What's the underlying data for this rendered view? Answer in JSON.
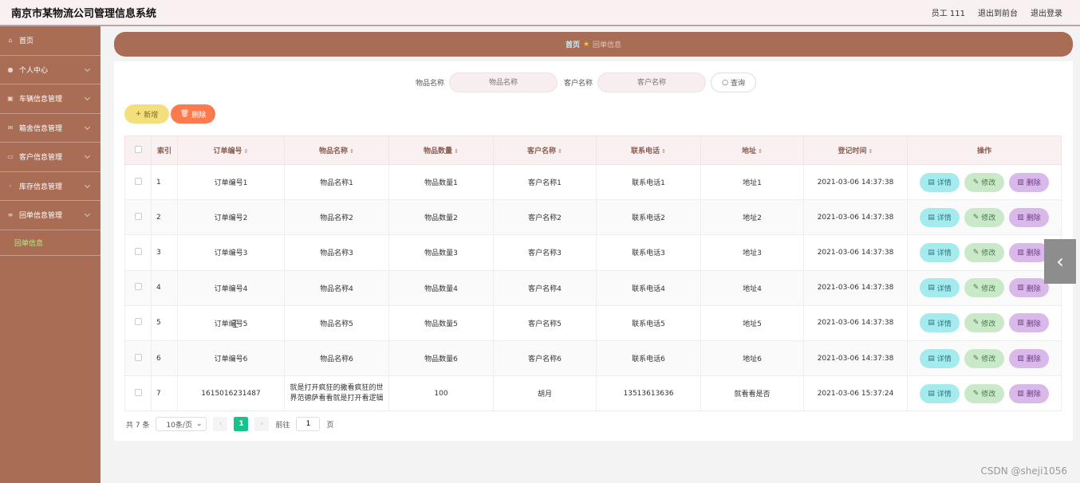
{
  "app": {
    "title": "南京市某物流公司管理信息系统"
  },
  "topbar": {
    "user": "员工 111",
    "to_front": "退出到前台",
    "logout": "退出登录"
  },
  "sidebar": {
    "items": [
      {
        "label": "首页",
        "icon": "home-icon"
      },
      {
        "label": "个人中心",
        "icon": "user-icon"
      },
      {
        "label": "车辆信息管理",
        "icon": "truck-icon"
      },
      {
        "label": "箱舍信息管理",
        "icon": "box-icon"
      },
      {
        "label": "客户信息管理",
        "icon": "customer-icon"
      },
      {
        "label": "库存信息管理",
        "icon": "stock-icon"
      },
      {
        "label": "回单信息管理",
        "icon": "list-icon"
      }
    ],
    "sub_item": "回单信息"
  },
  "breadcrumb": {
    "home": "首页",
    "current": "回单信息"
  },
  "search": {
    "label1": "物品名称",
    "placeholder1": "物品名称",
    "label2": "客户名称",
    "placeholder2": "客户名称",
    "button": "查询"
  },
  "actions": {
    "add": "新增",
    "delete": "删除"
  },
  "table": {
    "headers": [
      "索引",
      "订单编号",
      "物品名称",
      "物品数量",
      "客户名称",
      "联系电话",
      "地址",
      "登记时间",
      "操作"
    ],
    "rows": [
      {
        "idx": "1",
        "order": "订单编号1",
        "item": "物品名称1",
        "qty": "物品数量1",
        "cust": "客户名称1",
        "phone": "联系电话1",
        "addr": "地址1",
        "time": "2021-03-06 14:37:38"
      },
      {
        "idx": "2",
        "order": "订单编号2",
        "item": "物品名称2",
        "qty": "物品数量2",
        "cust": "客户名称2",
        "phone": "联系电话2",
        "addr": "地址2",
        "time": "2021-03-06 14:37:38"
      },
      {
        "idx": "3",
        "order": "订单编号3",
        "item": "物品名称3",
        "qty": "物品数量3",
        "cust": "客户名称3",
        "phone": "联系电话3",
        "addr": "地址3",
        "time": "2021-03-06 14:37:38"
      },
      {
        "idx": "4",
        "order": "订单编号4",
        "item": "物品名称4",
        "qty": "物品数量4",
        "cust": "客户名称4",
        "phone": "联系电话4",
        "addr": "地址4",
        "time": "2021-03-06 14:37:38"
      },
      {
        "idx": "5",
        "order": "订单编号5",
        "item": "物品名称5",
        "qty": "物品数量5",
        "cust": "客户名称5",
        "phone": "联系电话5",
        "addr": "地址5",
        "time": "2021-03-06 14:37:38"
      },
      {
        "idx": "6",
        "order": "订单编号6",
        "item": "物品名称6",
        "qty": "物品数量6",
        "cust": "客户名称6",
        "phone": "联系电话6",
        "addr": "地址6",
        "time": "2021-03-06 14:37:38"
      },
      {
        "idx": "7",
        "order": "1615016231487",
        "item": "就是打开疯狂的撒看疯狂的世界范德萨看看就是打开看逻辑",
        "qty": "100",
        "cust": "胡月",
        "phone": "13513613636",
        "addr": "就看看是否",
        "time": "2021-03-06 15:37:24"
      }
    ],
    "ops": {
      "detail": "详情",
      "edit": "修改",
      "delete": "删除"
    }
  },
  "pager": {
    "total": "共 7 条",
    "size": "10条/页",
    "current": "1",
    "goto": "前往",
    "goto_val": "1",
    "page": "页"
  },
  "watermark": "CSDN @sheji1056",
  "colors": {
    "sidebar": "#a96d55",
    "header": "#f9f0f1",
    "accent_green": "#19c28d"
  }
}
